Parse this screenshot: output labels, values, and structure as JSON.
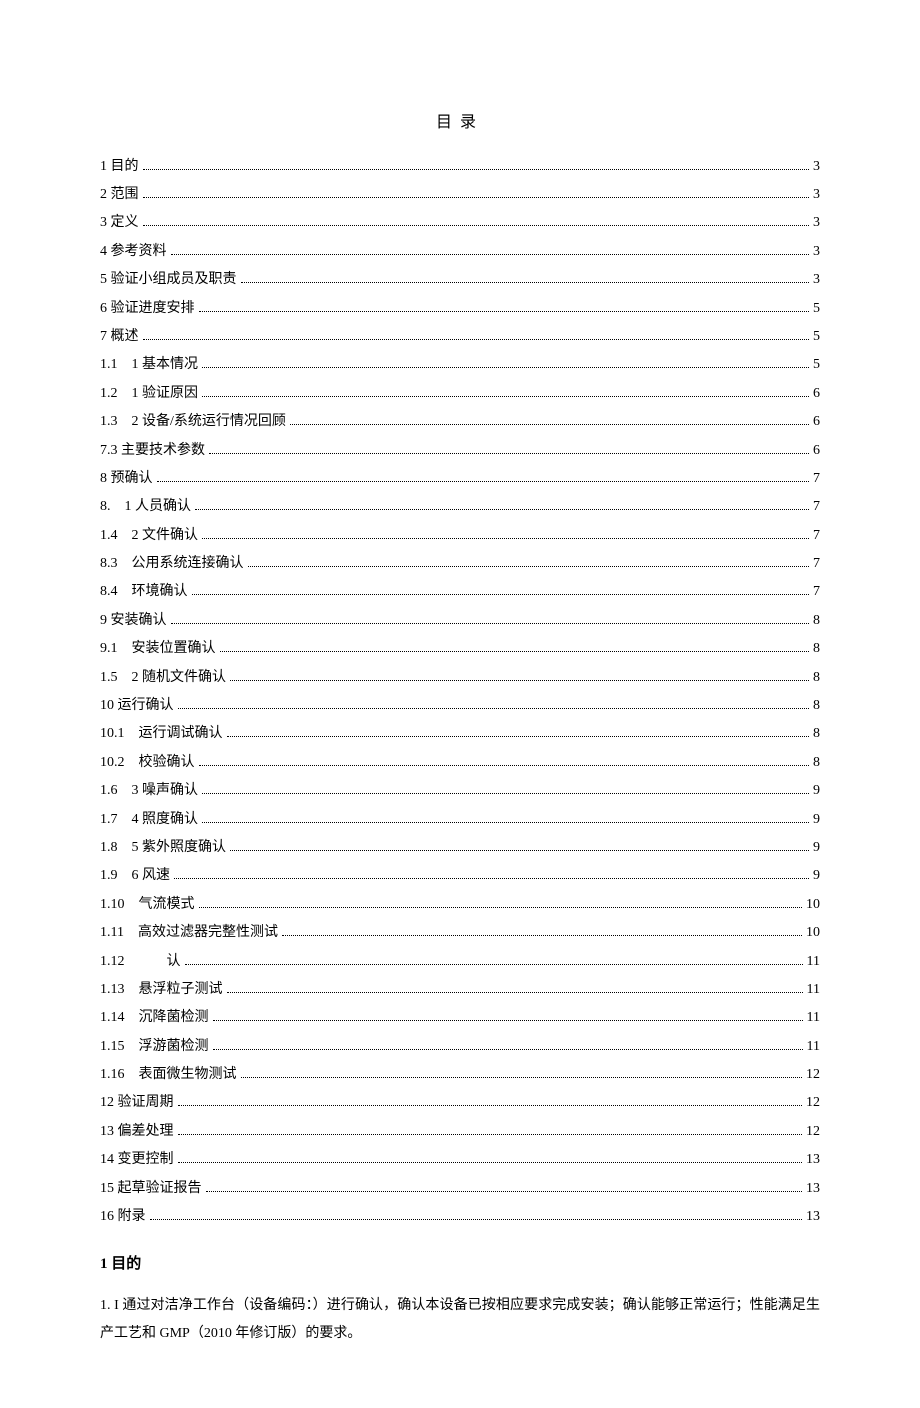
{
  "toc_title": "目录",
  "toc": [
    {
      "label": "1 目的",
      "page": "3"
    },
    {
      "label": "2 范围",
      "page": "3"
    },
    {
      "label": "3 定义",
      "page": "3"
    },
    {
      "label": "4 参考资料",
      "page": "3"
    },
    {
      "label": "5 验证小组成员及职责",
      "page": "3"
    },
    {
      "label": "6 验证进度安排",
      "page": "5"
    },
    {
      "label": "7 概述",
      "page": "5"
    },
    {
      "label": "1.1　1 基本情况",
      "page": "5"
    },
    {
      "label": "1.2　1 验证原因",
      "page": "6"
    },
    {
      "label": "1.3　2 设备/系统运行情况回顾",
      "page": "6"
    },
    {
      "label": "7.3 主要技术参数",
      "page": "6"
    },
    {
      "label": "8 预确认",
      "page": "7"
    },
    {
      "label": "8.　1 人员确认",
      "page": "7"
    },
    {
      "label": "1.4　2 文件确认",
      "page": "7"
    },
    {
      "label": "8.3　公用系统连接确认",
      "page": "7"
    },
    {
      "label": "8.4　环境确认",
      "page": "7"
    },
    {
      "label": "9 安装确认",
      "page": "8"
    },
    {
      "label": "9.1　安装位置确认",
      "page": "8"
    },
    {
      "label": "1.5　2 随机文件确认",
      "page": "8"
    },
    {
      "label": "10 运行确认",
      "page": "8"
    },
    {
      "label": "10.1　运行调试确认",
      "page": "8"
    },
    {
      "label": "10.2　校验确认",
      "page": "8"
    },
    {
      "label": "1.6　3 噪声确认",
      "page": "9"
    },
    {
      "label": "1.7　4 照度确认",
      "page": "9"
    },
    {
      "label": "1.8　5 紫外照度确认",
      "page": "9"
    },
    {
      "label": "1.9　6 风速",
      "page": "9"
    },
    {
      "label": "1.10　气流模式",
      "page": "10"
    },
    {
      "label": "1.11　高效过滤器完整性测试",
      "page": "10"
    },
    {
      "label": "1.12　　　认",
      "page": "11"
    },
    {
      "label": "1.13　悬浮粒子测试",
      "page": "11"
    },
    {
      "label": "1.14　沉降菌检测",
      "page": "11"
    },
    {
      "label": "1.15　浮游菌检测",
      "page": "11"
    },
    {
      "label": "1.16　表面微生物测试",
      "page": "12"
    },
    {
      "label": "12 验证周期",
      "page": "12"
    },
    {
      "label": "13 偏差处理",
      "page": "12"
    },
    {
      "label": "14 变更控制",
      "page": "13"
    },
    {
      "label": "15 起草验证报告",
      "page": "13"
    },
    {
      "label": "16 附录",
      "page": "13"
    }
  ],
  "section1": {
    "heading": "1 目的",
    "body": "1. I 通过对洁净工作台（设备编码：）进行确认，确认本设备已按相应要求完成安装；确认能够正常运行；性能满足生产工艺和 GMP（2010 年修订版）的要求。"
  }
}
